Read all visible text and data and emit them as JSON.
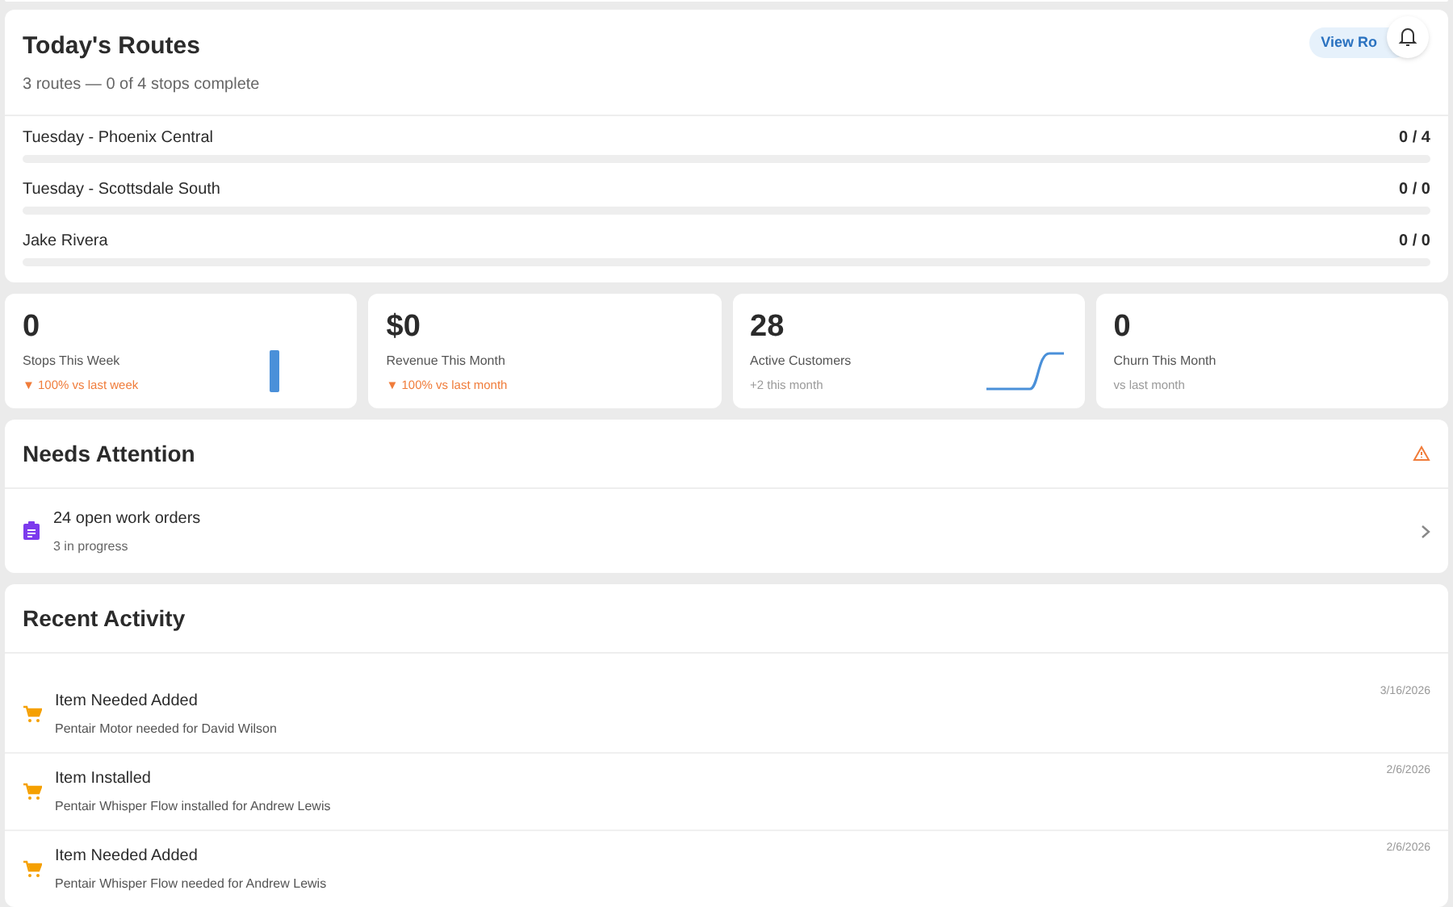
{
  "routes": {
    "title": "Today's Routes",
    "subtitle": "3 routes — 0 of 4 stops complete",
    "button": "View Ro",
    "items": [
      {
        "name": "Tuesday - Phoenix Central",
        "count": "0 / 4",
        "level": 0
      },
      {
        "name": "Tuesday - Scottsdale South",
        "count": "0 / 0",
        "level": 0
      },
      {
        "name": "Jake Rivera",
        "count": "0 / 0",
        "level": 0
      }
    ]
  },
  "stats": [
    {
      "value": "0",
      "label": "Stops This Week",
      "trend": {
        "text": "▼ 100% vs last week",
        "kind": "down"
      },
      "chart": {
        "kind": "bar"
      }
    },
    {
      "value": "$0",
      "label": "Revenue This Month",
      "trend": {
        "text": "▼ 100% vs last month",
        "kind": "down"
      }
    },
    {
      "value": "28",
      "label": "Active Customers",
      "trend": {
        "text": "+2 this month",
        "kind": "neutral"
      },
      "chart": {
        "kind": "line"
      }
    },
    {
      "value": "0",
      "label": "Churn This Month",
      "trend": {
        "text": "vs last month",
        "kind": "neutral"
      }
    }
  ],
  "attention": {
    "title": "Needs Attention",
    "items": [
      {
        "title": "24 open work orders",
        "subtitle": "3 in progress"
      }
    ]
  },
  "activity": {
    "title": "Recent Activity",
    "items": [
      {
        "title": "Item Needed Added",
        "detail": "Pentair Motor needed for David Wilson",
        "date": "3/16/2026"
      },
      {
        "title": "Item Installed",
        "detail": "Pentair Whisper Flow installed for Andrew Lewis",
        "date": "2/6/2026"
      },
      {
        "title": "Item Needed Added",
        "detail": "Pentair Whisper Flow needed for Andrew Lewis",
        "date": "2/6/2026"
      }
    ]
  }
}
